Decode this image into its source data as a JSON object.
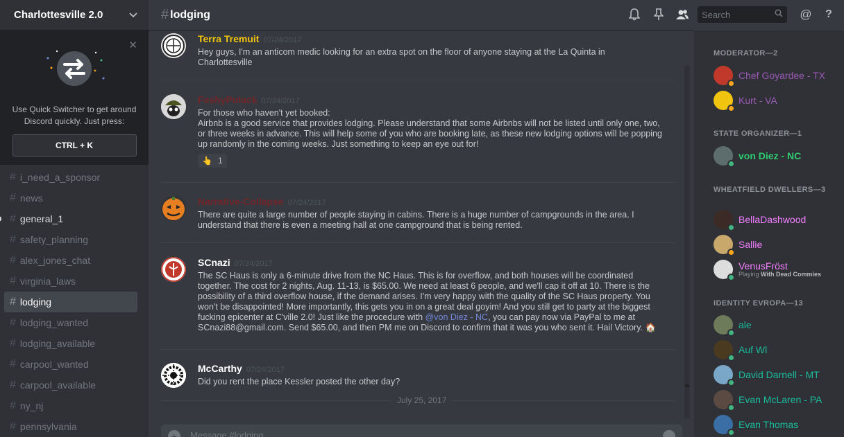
{
  "guild": {
    "name": "Charlottesville 2.0"
  },
  "quick_switcher": {
    "text": "Use Quick Switcher to get around Discord quickly. Just press:",
    "shortcut": "CTRL + K"
  },
  "channels": [
    {
      "name": "i_need_a_sponsor",
      "state": "muted"
    },
    {
      "name": "news",
      "state": "muted"
    },
    {
      "name": "general_1",
      "state": "unread"
    },
    {
      "name": "safety_planning",
      "state": "muted"
    },
    {
      "name": "alex_jones_chat",
      "state": "muted"
    },
    {
      "name": "virginia_laws",
      "state": "muted"
    },
    {
      "name": "lodging",
      "state": "selected"
    },
    {
      "name": "lodging_wanted",
      "state": "muted"
    },
    {
      "name": "lodging_available",
      "state": "muted"
    },
    {
      "name": "carpool_wanted",
      "state": "muted"
    },
    {
      "name": "carpool_available",
      "state": "muted"
    },
    {
      "name": "ny_nj",
      "state": "muted"
    },
    {
      "name": "pennsylvania",
      "state": "muted"
    }
  ],
  "header": {
    "channel": "lodging",
    "search_placeholder": "Search",
    "icons": [
      "bell-icon",
      "pin-icon",
      "members-icon",
      "search-icon",
      "at-icon",
      "help-icon"
    ]
  },
  "messages": [
    {
      "author": "Terra Tremuit",
      "author_color": "#f1c40f",
      "timestamp": "07/24/2017",
      "text": "Hey guys, I'm an anticom medic looking for an extra spot on the floor of anyone staying at the La Quinta in\nCharlottesville"
    },
    {
      "author": "FashyPolack",
      "author_color": "#71262a",
      "timestamp": "07/24/2017",
      "text": "For those who haven't yet booked:\nAirbnb is a good service that provides lodging. Please understand that some Airbnbs will not be listed until only one, two,\nor three weeks in advance. This will help some of you who are booking late, as these new lodging options will be popping\nup randomly in the coming weeks. Just something to keep an eye out for!",
      "reaction": {
        "emoji": "👆",
        "count": "1"
      }
    },
    {
      "author": "Narrative-Collapse",
      "author_color": "#71262a",
      "timestamp": "07/24/2017",
      "text": "There are quite a large number of people staying in cabins. There is a huge number of campgrounds in the area. I\nunderstand that there is even a meeting hall at one campground that is being rented."
    },
    {
      "author": "SCnazi",
      "author_color": "#ffffff",
      "timestamp": "07/24/2017",
      "text_before": "The SC Haus is only a 6-minute drive from the NC Haus. This is for overflow, and both houses will be coordinated\ntogether. The cost for 2 nights, Aug. 11-13, is $65.00. We need at least 6 people, and we'll cap it off at 10. There is the\npossibility of a third overflow house, if the demand arises. I'm very happy with the quality of the SC Haus property. You\nwon't be disappointed! More importantly, this gets you in on a great deal goyim! And you still get to party at the biggest\nfucking epicenter at C'ville 2.0! Just like the procedure with ",
      "mention": "@von Diez - NC",
      "text_after": ", you can pay now via PayPal to me at\nSCnazi88@gmail.com. Send $65.00, and then PM me on Discord to confirm that it was you who sent it. Hail Victory. 🏠"
    },
    {
      "author": "McCarthy",
      "author_color": "#ffffff",
      "timestamp": "07/24/2017",
      "text": "Did you rent the place Kessler posted the other day?"
    }
  ],
  "date_divider": "July 25, 2017",
  "composer": {
    "placeholder": "Message #lodging"
  },
  "member_list": {
    "roles": [
      {
        "header": "MODERATOR—2"
      },
      {
        "header": "STATE ORGANIZER—1"
      },
      {
        "header": "WHEATFIELD DWELLERS—3"
      },
      {
        "header": "IDENTITY EVROPA—13"
      }
    ],
    "members": [
      {
        "name": "Chef Goyardee - TX",
        "color": "#9b59b6",
        "status": "#faa61a",
        "avatar": "#c0392b"
      },
      {
        "name": "Kurt - VA",
        "color": "#9b59b6",
        "status": "#faa61a",
        "avatar": "#f1c40f"
      },
      {
        "name": "von Diez - NC",
        "color": "#2ecc71",
        "status": "#43b581",
        "avatar": "#5d6d6e"
      },
      {
        "name": "BellaDashwood",
        "color": "#f47fff",
        "status": "#43b581",
        "avatar": "#3b2a25"
      },
      {
        "name": "Sallie",
        "color": "#f47fff",
        "status": "#faa61a",
        "avatar": "#c8a86b"
      },
      {
        "name": "VenusFröst",
        "color": "#f47fff",
        "status": "#43b581",
        "avatar": "#dddddd",
        "activity_prefix": "Playing",
        "activity": "With Dead Commies"
      },
      {
        "name": "ale",
        "color": "#1abc9c",
        "status": "#43b581",
        "avatar": "#6d7b5a"
      },
      {
        "name": "Auf Wl",
        "color": "#1abc9c",
        "status": "#43b581",
        "avatar": "#4a3b20"
      },
      {
        "name": "David Darnell - MT",
        "color": "#1abc9c",
        "status": "#43b581",
        "avatar": "#7aa7c7"
      },
      {
        "name": "Evan McLaren - PA",
        "color": "#1abc9c",
        "status": "#43b581",
        "avatar": "#5a4a42"
      },
      {
        "name": "Evan Thomas",
        "color": "#1abc9c",
        "status": "#43b581",
        "avatar": "#3a6ea5"
      }
    ]
  }
}
